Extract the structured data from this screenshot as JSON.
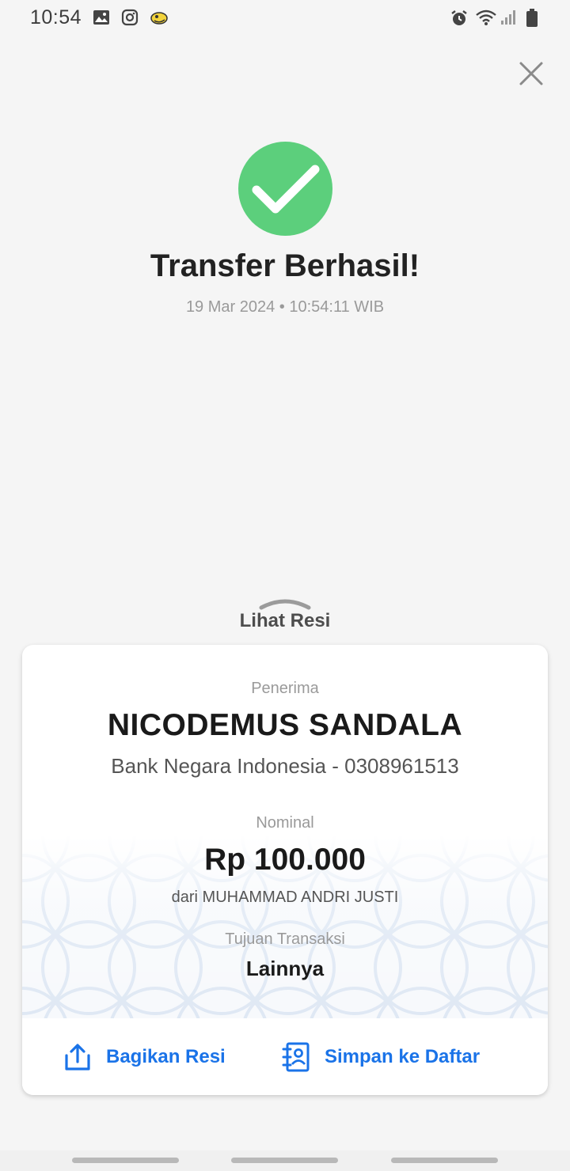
{
  "status_bar": {
    "time": "10:54",
    "icons_left": [
      "gallery-icon",
      "instagram-icon",
      "app-icon"
    ],
    "icons_right": [
      "alarm-icon",
      "wifi-icon",
      "signal-icon",
      "battery-icon"
    ]
  },
  "success": {
    "title": "Transfer Berhasil!",
    "datetime": "19 Mar 2024 • 10:54:11 WIB",
    "color": "#5ccf7c"
  },
  "receipt_toggle": {
    "label": "Lihat Resi"
  },
  "receipt": {
    "recipient_label": "Penerima",
    "recipient_name": "NICODEMUS SANDALA",
    "recipient_bank": "Bank Negara Indonesia - 0308961513",
    "amount_label": "Nominal",
    "amount": "Rp 100.000",
    "sender": "dari MUHAMMAD ANDRI JUSTI",
    "purpose_label": "Tujuan Transaksi",
    "purpose": "Lainnya"
  },
  "actions": {
    "share_label": "Bagikan Resi",
    "save_label": "Simpan ke Daftar",
    "accent": "#1a73e8"
  }
}
